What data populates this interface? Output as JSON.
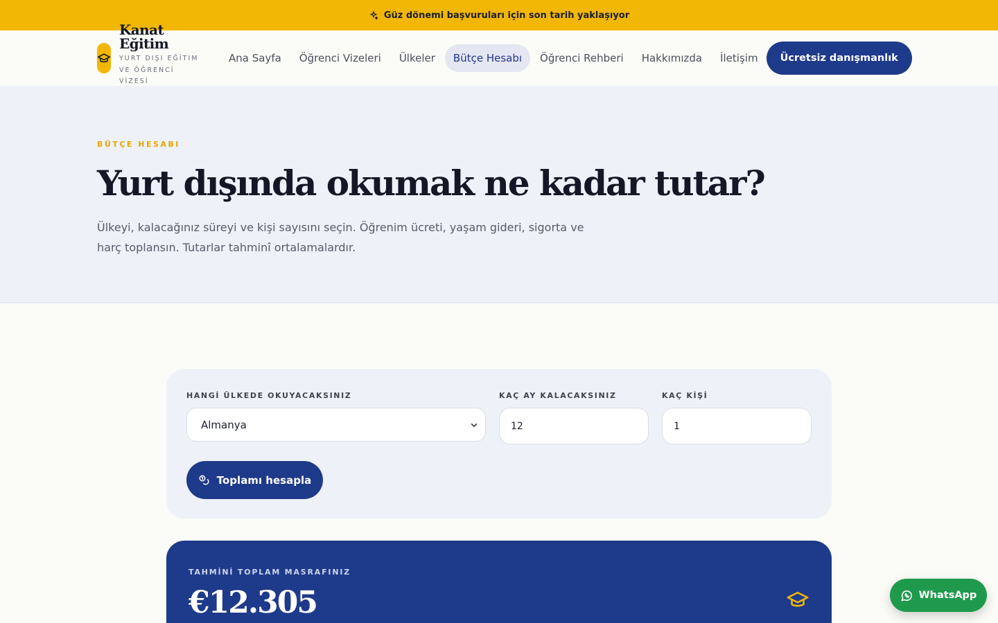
{
  "announcement": {
    "text": "Güz dönemi başvuruları için son tarih yaklaşıyor",
    "icon": "sparkle-icon"
  },
  "brand": {
    "name": "Kanat Eğitim",
    "tagline": "YURT DIŞI EĞİTIM VE ÖĞRENCİ VİZESİ",
    "logo_icon": "graduation-cap-icon"
  },
  "nav": {
    "items": [
      {
        "label": "Ana Sayfa"
      },
      {
        "label": "Öğrenci Vizeleri"
      },
      {
        "label": "Ülkeler"
      },
      {
        "label": "Bütçe Hesabı"
      },
      {
        "label": "Öğrenci Rehberi"
      },
      {
        "label": "Hakkımızda"
      },
      {
        "label": "İletişim"
      }
    ],
    "active": "Bütçe Hesabı",
    "cta_label": "Ücretsiz danışmanlık"
  },
  "hero": {
    "eyebrow": "BÜTÇE HESABI",
    "title": "Yurt dışında okumak ne kadar tutar?",
    "description": "Ülkeyi, kalacağınız süreyi ve kişi sayısını seçin. Öğrenim ücreti, yaşam gideri, sigorta ve harç toplansın. Tutarlar tahminî ortalamalardır."
  },
  "calculator": {
    "country_label": "HANGİ ÜLKEDE OKUYACAKSINIZ",
    "country_value": "Almanya",
    "months_label": "KAÇ AY KALACAKSINIZ",
    "months_value": "12",
    "people_label": "KAÇ KİŞİ",
    "people_value": "1",
    "submit_label": "Toplamı hesapla",
    "submit_icon": "coins-icon"
  },
  "result": {
    "label": "TAHMİNİ TOPLAM MASRAFINIZ",
    "value": "€12.305",
    "icon": "graduation-cap-icon"
  },
  "whatsapp": {
    "label": "WhatsApp",
    "icon": "whatsapp-icon"
  },
  "colors": {
    "accent_yellow": "#f2b705",
    "primary_navy": "#1e3a8a",
    "hero_bg": "#eef1f8",
    "page_bg": "#fbfbf7",
    "whatsapp_green": "#1f9a4c"
  }
}
